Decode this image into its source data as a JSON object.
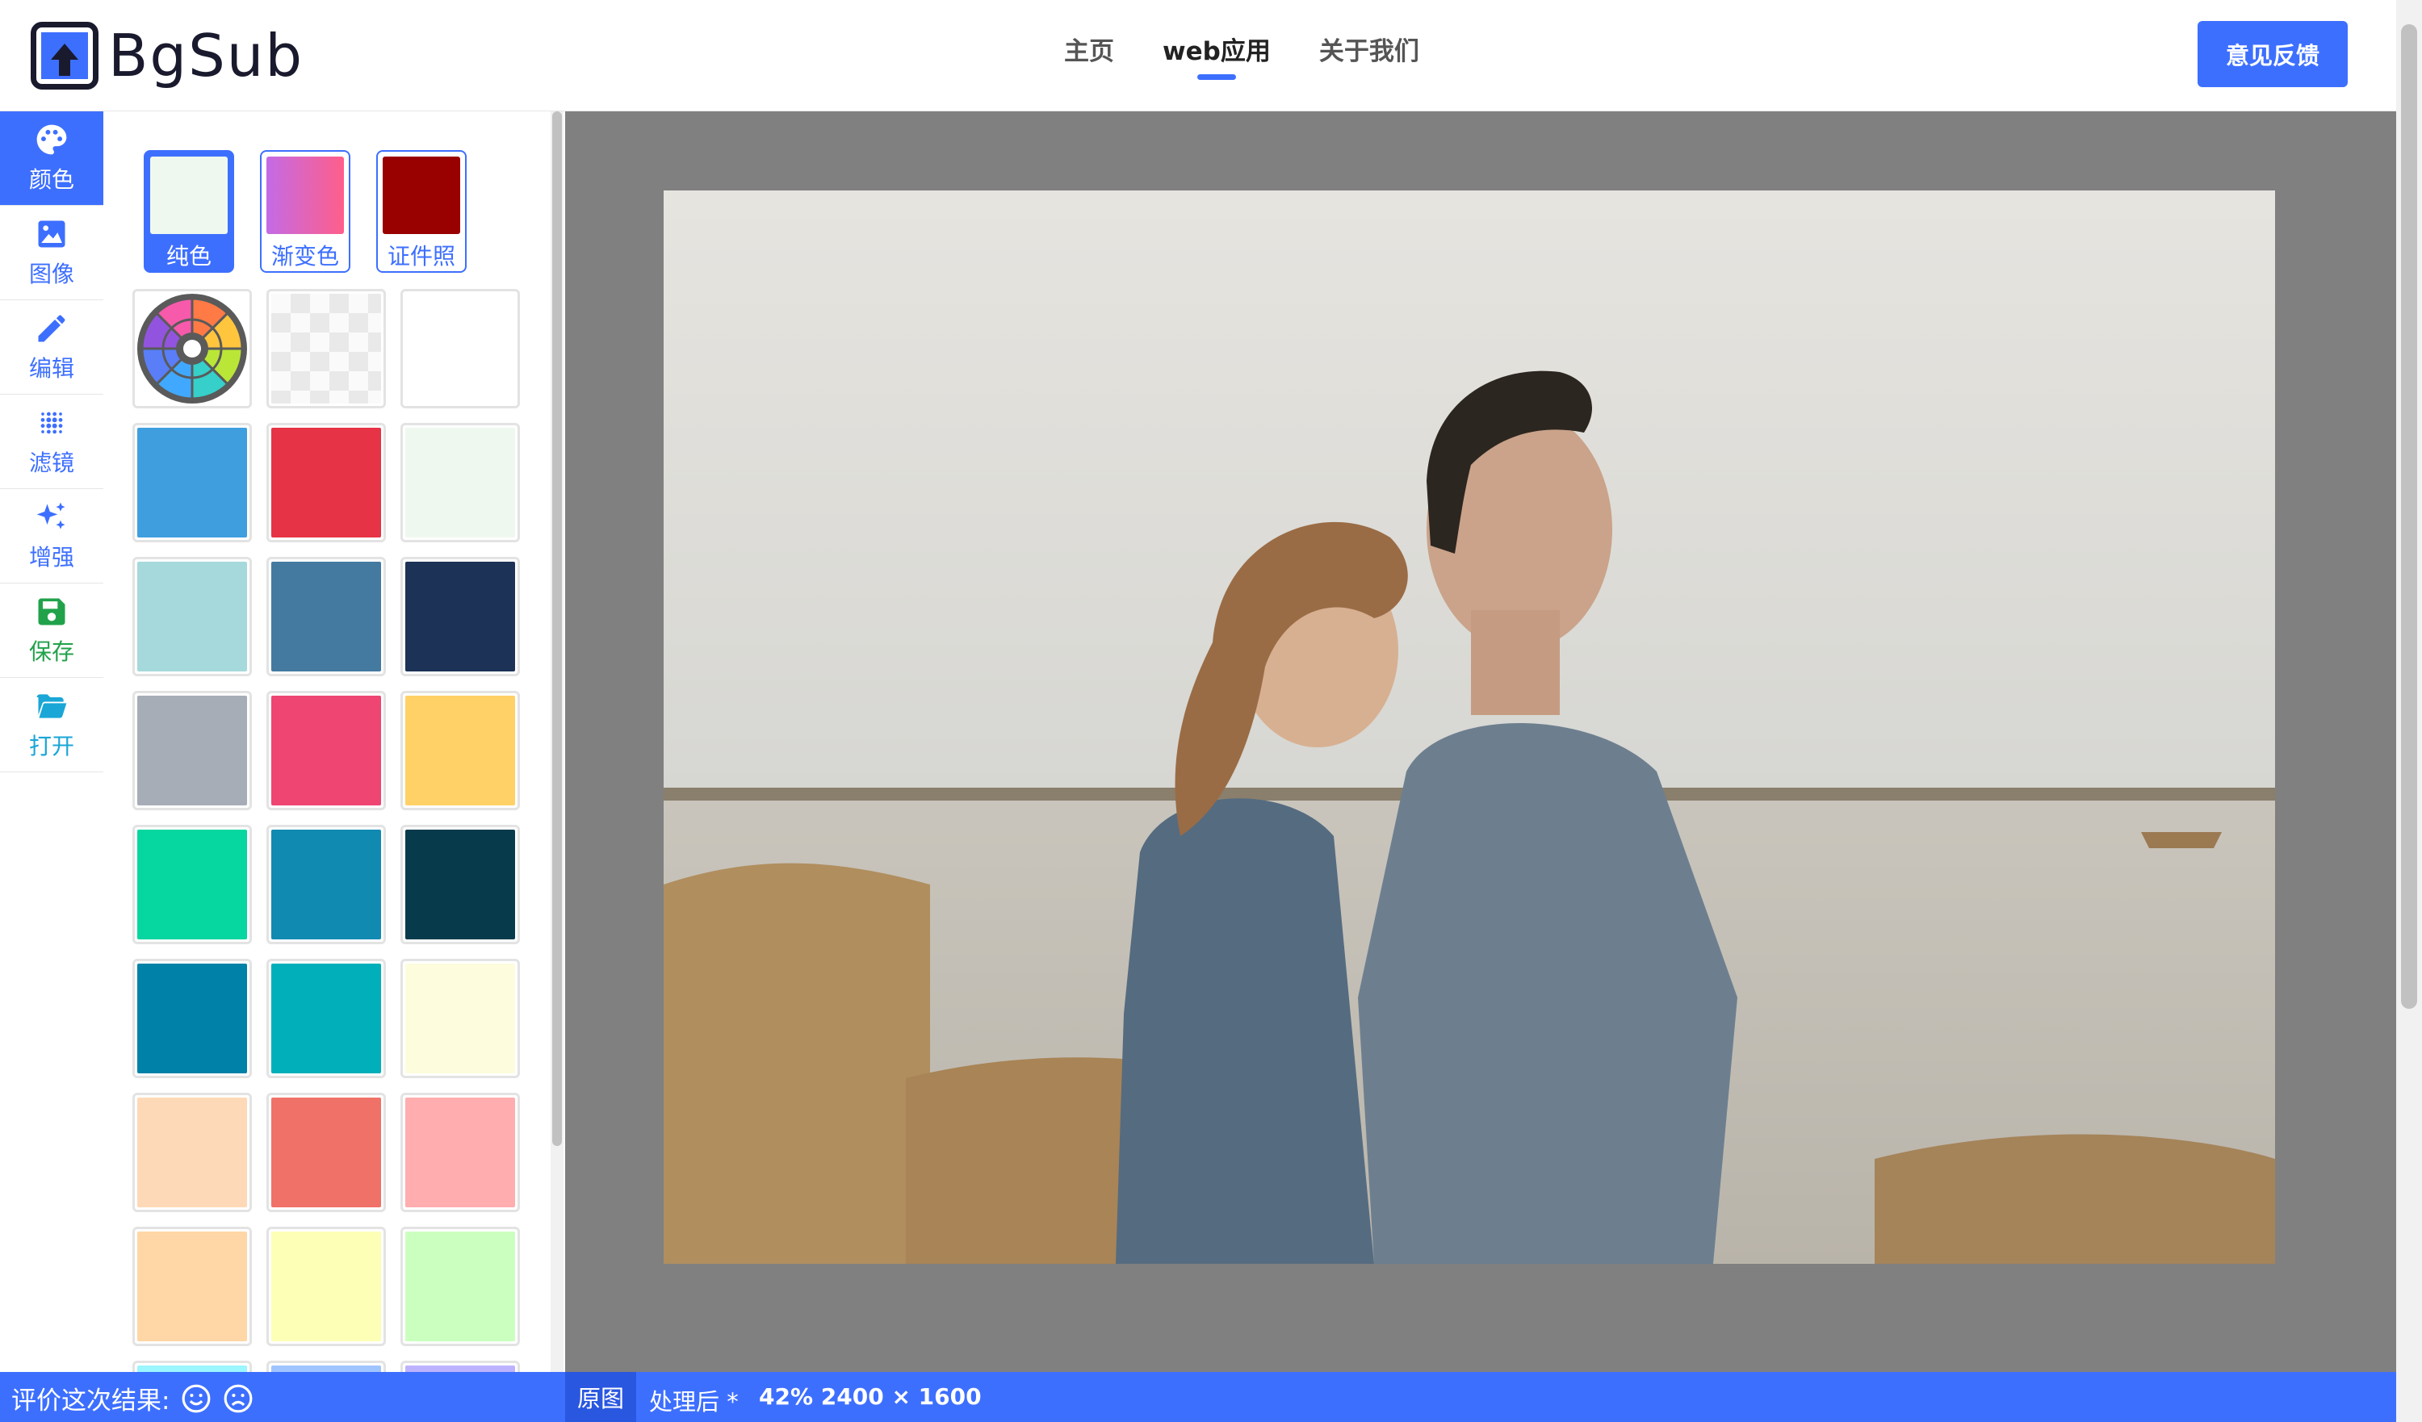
{
  "header": {
    "logo_text": "BgSub",
    "nav": [
      "主页",
      "web应用",
      "关于我们"
    ],
    "active_nav": 1,
    "feedback_label": "意见反馈"
  },
  "toolbar": {
    "items": [
      {
        "label": "颜色",
        "icon": "palette-icon"
      },
      {
        "label": "图像",
        "icon": "image-icon"
      },
      {
        "label": "编辑",
        "icon": "pencil-icon"
      },
      {
        "label": "滤镜",
        "icon": "dots-filter-icon"
      },
      {
        "label": "增强",
        "icon": "sparkle-icon"
      },
      {
        "label": "保存",
        "icon": "save-icon"
      },
      {
        "label": "打开",
        "icon": "folder-open-icon"
      }
    ],
    "active": 0
  },
  "color_panel": {
    "type_tabs": [
      {
        "label": "纯色",
        "swatch": "#eef8ef"
      },
      {
        "label": "渐变色",
        "swatch": "gradient"
      },
      {
        "label": "证件照",
        "swatch": "#990000"
      }
    ],
    "active_tab": 0,
    "swatches": [
      "color-wheel",
      "transparent",
      "#ffffff",
      "#3f9fde",
      "#e63345",
      "#eff8ef",
      "#a6d9dc",
      "#447aa0",
      "#1c3256",
      "#a7adb7",
      "#ee4573",
      "#ffd166",
      "#06d6a0",
      "#118ab2",
      "#073b4c",
      "#0081a7",
      "#00afb9",
      "#fdfcdc",
      "#fed9b7",
      "#f07167",
      "#ffadaf",
      "#ffd6a5",
      "#fdffb6",
      "#caffbf",
      "#9bf6ff",
      "#a0c4ff",
      "#bdb2ff"
    ]
  },
  "canvas": {
    "background": "#808080",
    "photo_alt": "photo-couple-by-lake"
  },
  "statusbar": {
    "rate_label": "评价这次结果:",
    "tab_original": "原图",
    "tab_processed": "处理后 *",
    "info": "42% 2400 × 1600"
  },
  "colors": {
    "accent": "#3d6fff",
    "save_green": "#21a24a",
    "open_cyan": "#1aa6d6"
  }
}
